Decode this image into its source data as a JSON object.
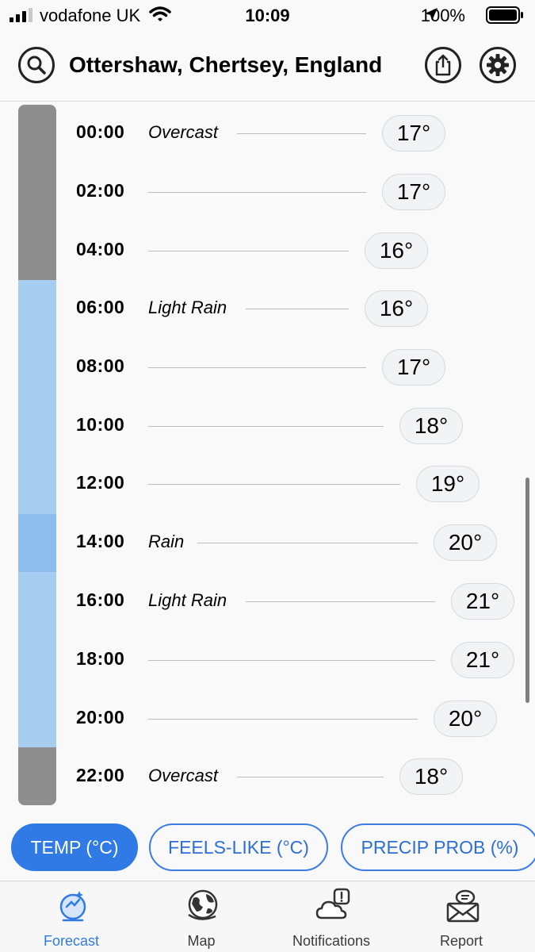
{
  "status_bar": {
    "carrier": "vodafone UK",
    "time": "10:09",
    "battery": "100%"
  },
  "header": {
    "location": "Ottershaw, Chertsey, England"
  },
  "forecast": [
    {
      "time": "00:00",
      "condition": "Overcast",
      "temp": "17°"
    },
    {
      "time": "02:00",
      "condition": "",
      "temp": "17°"
    },
    {
      "time": "04:00",
      "condition": "",
      "temp": "16°"
    },
    {
      "time": "06:00",
      "condition": "Light Rain",
      "temp": "16°"
    },
    {
      "time": "08:00",
      "condition": "",
      "temp": "17°"
    },
    {
      "time": "10:00",
      "condition": "",
      "temp": "18°"
    },
    {
      "time": "12:00",
      "condition": "",
      "temp": "19°"
    },
    {
      "time": "14:00",
      "condition": "Rain",
      "temp": "20°"
    },
    {
      "time": "16:00",
      "condition": "Light Rain",
      "temp": "21°"
    },
    {
      "time": "18:00",
      "condition": "",
      "temp": "21°"
    },
    {
      "time": "20:00",
      "condition": "",
      "temp": "20°"
    },
    {
      "time": "22:00",
      "condition": "Overcast",
      "temp": "18°"
    }
  ],
  "chips": [
    {
      "label": "TEMP (°C)",
      "active": true
    },
    {
      "label": "FEELS-LIKE (°C)",
      "active": false
    },
    {
      "label": "PRECIP PROB (%)",
      "active": false
    }
  ],
  "tabs": [
    {
      "label": "Forecast",
      "icon": "forecast-icon",
      "active": true
    },
    {
      "label": "Map",
      "icon": "globe-icon",
      "active": false
    },
    {
      "label": "Notifications",
      "icon": "cloud-alert-icon",
      "active": false
    },
    {
      "label": "Report",
      "icon": "mail-report-icon",
      "active": false
    }
  ],
  "colors": {
    "accent": "#2f7ae5",
    "overcast": "#8e8e8e",
    "light_rain": "#a7cdf0",
    "rain": "#8cbdec"
  }
}
